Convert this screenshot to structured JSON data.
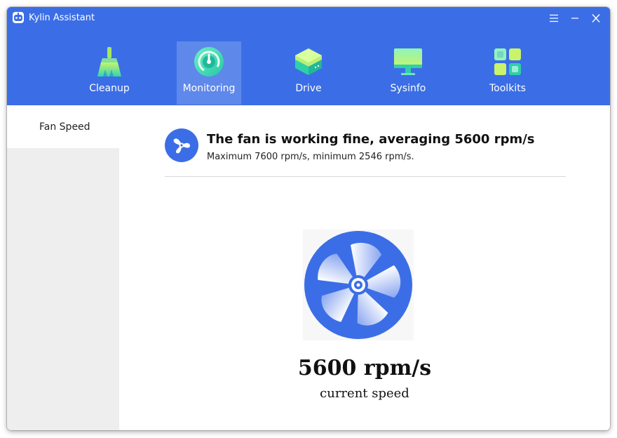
{
  "window": {
    "title": "Kylin Assistant"
  },
  "titlebar": {
    "icons": [
      "kylin-assistant-logo-icon",
      "menu-icon",
      "minimize-icon",
      "close-icon"
    ]
  },
  "nav": {
    "items": [
      {
        "label": "Cleanup",
        "icon": "broom-icon",
        "active": false
      },
      {
        "label": "Monitoring",
        "icon": "gauge-icon",
        "active": true
      },
      {
        "label": "Drive",
        "icon": "stack-icon",
        "active": false
      },
      {
        "label": "Sysinfo",
        "icon": "monitor-icon",
        "active": false
      },
      {
        "label": "Toolkits",
        "icon": "grid-icon",
        "active": false
      }
    ]
  },
  "sidebar": {
    "items": [
      {
        "label": "Fan Speed",
        "active": true
      }
    ]
  },
  "fan": {
    "status_title": "The fan is working fine, averaging 5600 rpm/s",
    "status_detail": "Maximum 7600 rpm/s, minimum 2546 rpm/s.",
    "speed_value": "5600 rpm/s",
    "speed_caption": "current speed"
  },
  "colors": {
    "header": "#3b6ee6",
    "accent": "#3b6ee6",
    "sidebar": "#eeeeee",
    "active_tab": "rgba(255,255,255,0.18)"
  }
}
